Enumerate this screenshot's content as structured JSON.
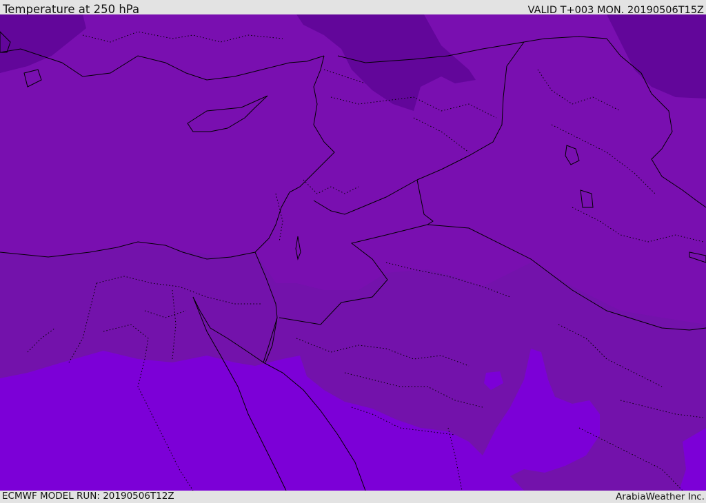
{
  "header": {
    "title": "Temperature at 250 hPa",
    "valid": "VALID T+003 MON. 20190506T15Z"
  },
  "footer": {
    "model_run": "ECMWF MODEL RUN: 20190506T12Z",
    "credit": "ArabiaWeather Inc."
  },
  "map": {
    "variable": "Temperature",
    "level": "250 hPa",
    "colors": {
      "cold_band": "#62069a",
      "main_band": "#790fb0",
      "mid_band": "#7312ab",
      "warm_band": "#7c00d7",
      "coast_lines": "#000000"
    }
  }
}
